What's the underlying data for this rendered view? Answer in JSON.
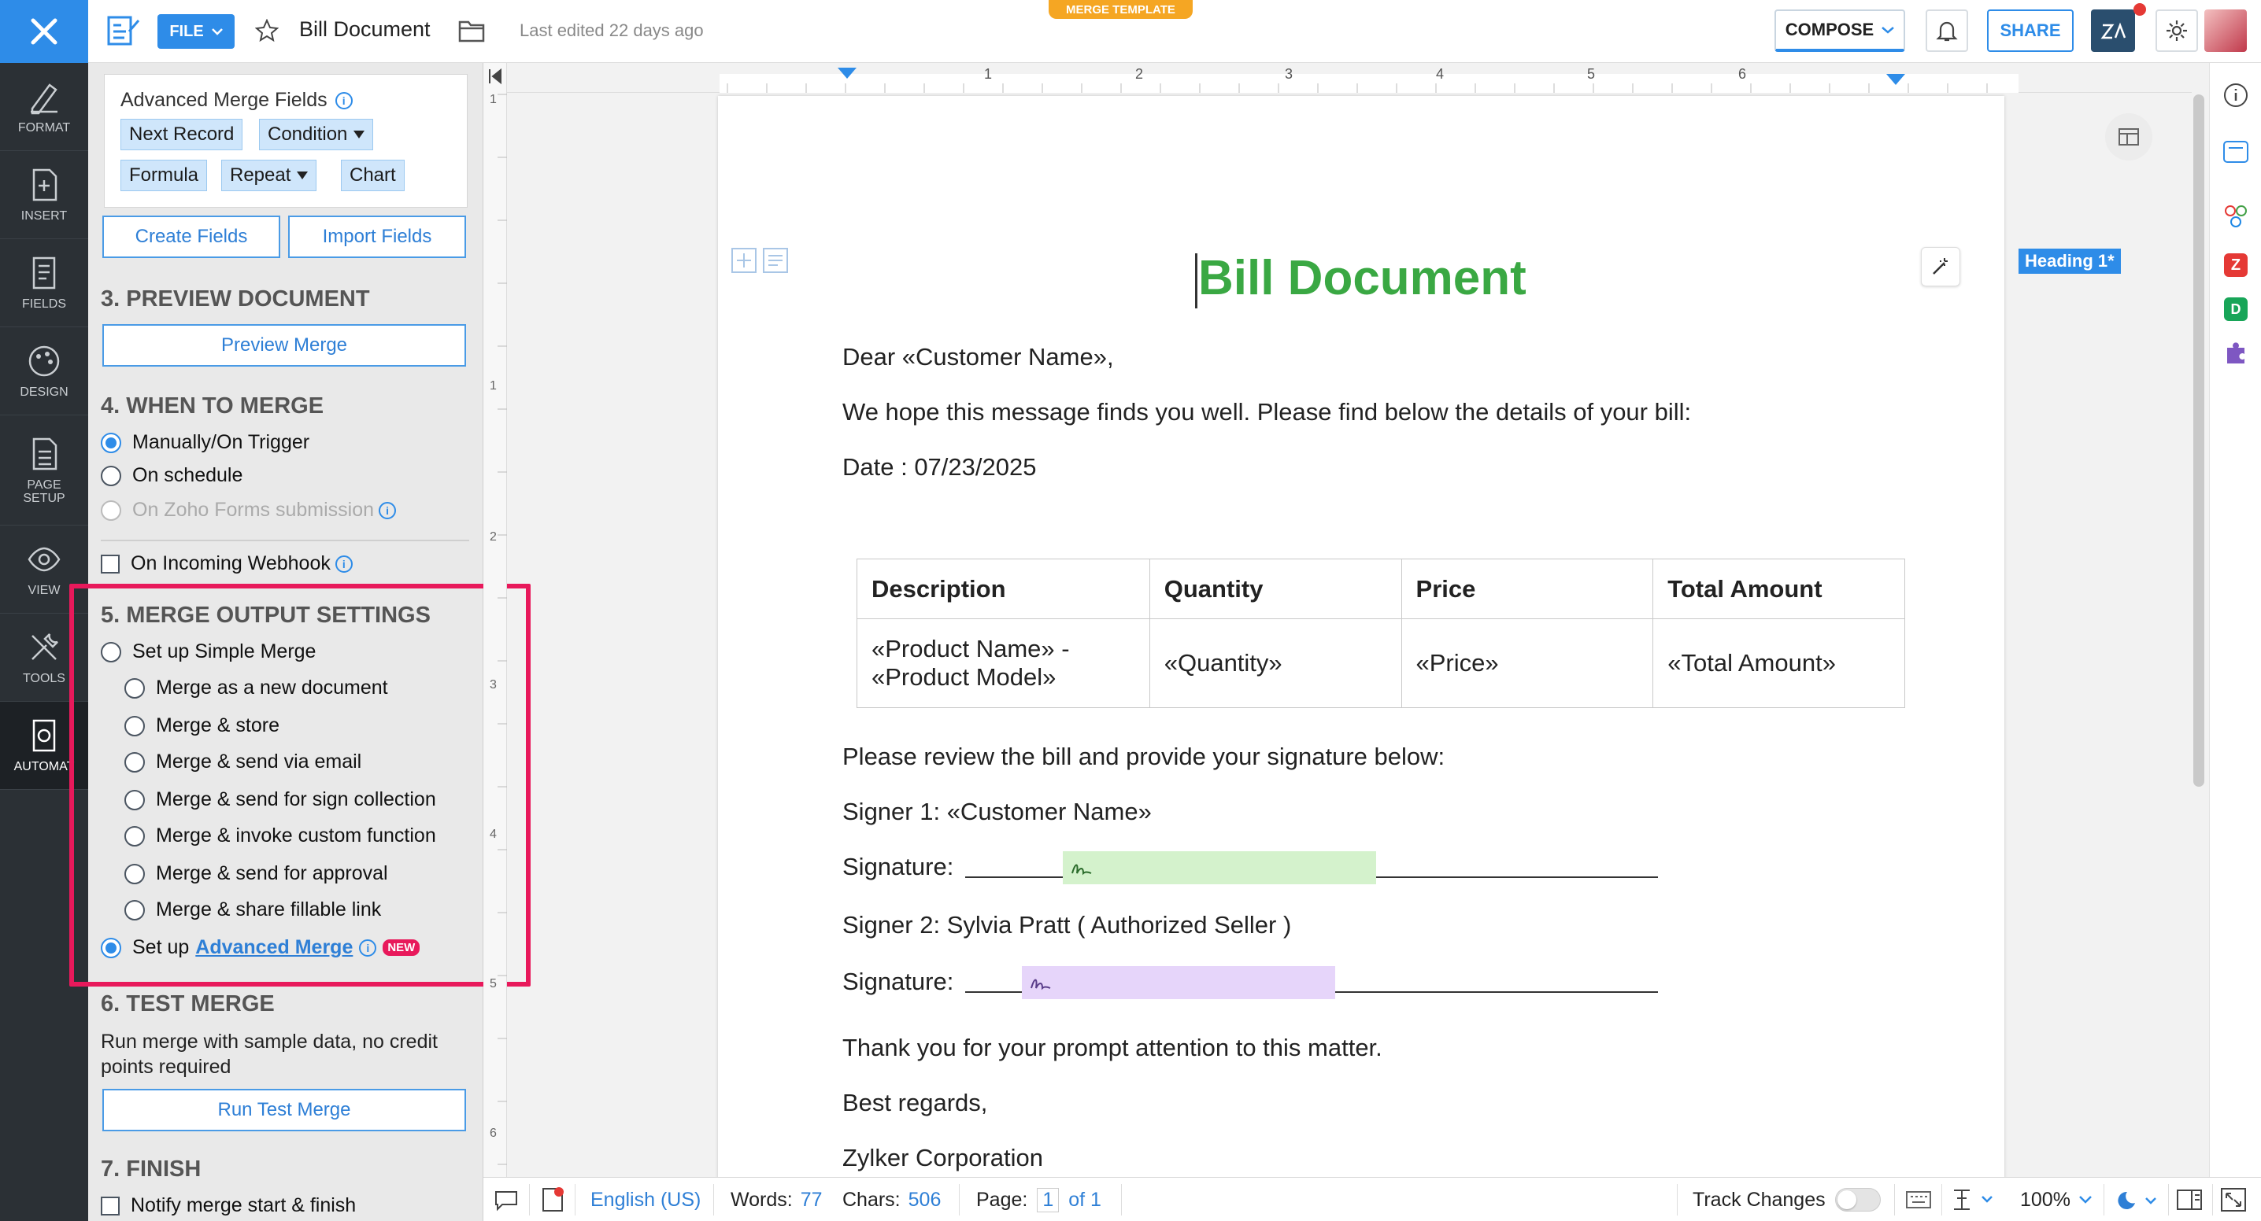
{
  "rail": {
    "items": [
      {
        "label": "FORMAT",
        "icon": "format-brush-icon"
      },
      {
        "label": "INSERT",
        "icon": "insert-doc-icon"
      },
      {
        "label": "FIELDS",
        "icon": "fields-doc-icon"
      },
      {
        "label": "DESIGN",
        "icon": "palette-icon"
      },
      {
        "label": "PAGE SETUP",
        "icon": "page-setup-icon"
      },
      {
        "label": "VIEW",
        "icon": "eye-icon"
      },
      {
        "label": "TOOLS",
        "icon": "tools-icon"
      },
      {
        "label": "AUTOMAT",
        "icon": "automate-gear-icon"
      }
    ]
  },
  "topbar": {
    "file_label": "FILE",
    "doc_title": "Bill Document",
    "last_edited": "Last edited 22 days ago",
    "badge": "MERGE TEMPLATE",
    "compose_label": "COMPOSE",
    "share_label": "SHARE"
  },
  "panel": {
    "advanced_fields_title": "Advanced Merge Fields",
    "chips": {
      "next_record": "Next Record",
      "condition": "Condition",
      "formula": "Formula",
      "repeat": "Repeat",
      "chart": "Chart"
    },
    "create_fields": "Create Fields",
    "import_fields": "Import Fields",
    "preview_heading": "3. PREVIEW DOCUMENT",
    "preview_merge": "Preview Merge",
    "when_heading": "4. WHEN TO MERGE",
    "when_options": {
      "manual": "Manually/On Trigger",
      "schedule": "On schedule",
      "zoho_forms": "On Zoho Forms submission",
      "webhook": "On Incoming Webhook"
    },
    "output_heading": "5. MERGE OUTPUT SETTINGS",
    "simple_merge": "Set up Simple Merge",
    "output_options": [
      "Merge as a new document",
      "Merge & store",
      "Merge & send via email",
      "Merge & send for sign collection",
      "Merge & invoke custom function",
      "Merge & send for approval",
      "Merge & share fillable link"
    ],
    "advanced_prefix": "Set up",
    "advanced_link": "Advanced Merge",
    "new_badge": "NEW",
    "test_heading": "6. TEST MERGE",
    "test_desc_1": "Run merge with sample data, no credit",
    "test_desc_2": "points required",
    "run_test": "Run Test Merge",
    "finish_heading": "7. FINISH",
    "notify": "Notify merge start & finish"
  },
  "ruler": {
    "h": [
      "1",
      "2",
      "3",
      "4",
      "5",
      "6"
    ],
    "v": [
      "1",
      "1",
      "2",
      "3",
      "4",
      "5",
      "6"
    ]
  },
  "doc": {
    "heading": "Bill Document",
    "greeting": "Dear «Customer Name»,",
    "intro": "We hope this message finds you well. Please find below the details of your bill:",
    "date": "Date : 07/23/2025",
    "table": {
      "headers": [
        "Description",
        "Quantity",
        "Price",
        "Total Amount"
      ],
      "row": {
        "desc_1": "«Product Name» -",
        "desc_2": "«Product Model»",
        "qty": "«Quantity»",
        "price": "«Price»",
        "total": "«Total Amount»"
      }
    },
    "review": "Please review the bill and provide your signature below:",
    "signer1": "Signer 1: «Customer Name»",
    "signature_label": "Signature:",
    "signer2": "Signer 2: Sylvia Pratt ( Authorized Seller )",
    "thanks": "Thank you for your prompt attention to this matter.",
    "regards": "Best regards,",
    "company": "Zylker Corporation",
    "heading_style": "Heading 1*"
  },
  "status": {
    "language": "English (US)",
    "words_label": "Words:",
    "words": "77",
    "chars_label": "Chars:",
    "chars": "506",
    "page_label": "Page:",
    "page_num": "1",
    "page_of": "of 1",
    "track_changes": "Track Changes",
    "zoom": "100%"
  },
  "colors": {
    "accent": "#2e8ce8",
    "heading_green": "#3aa843",
    "highlight": "#e8195b",
    "sig1": "#d4f2cc",
    "sig2": "#e6d5fa"
  }
}
